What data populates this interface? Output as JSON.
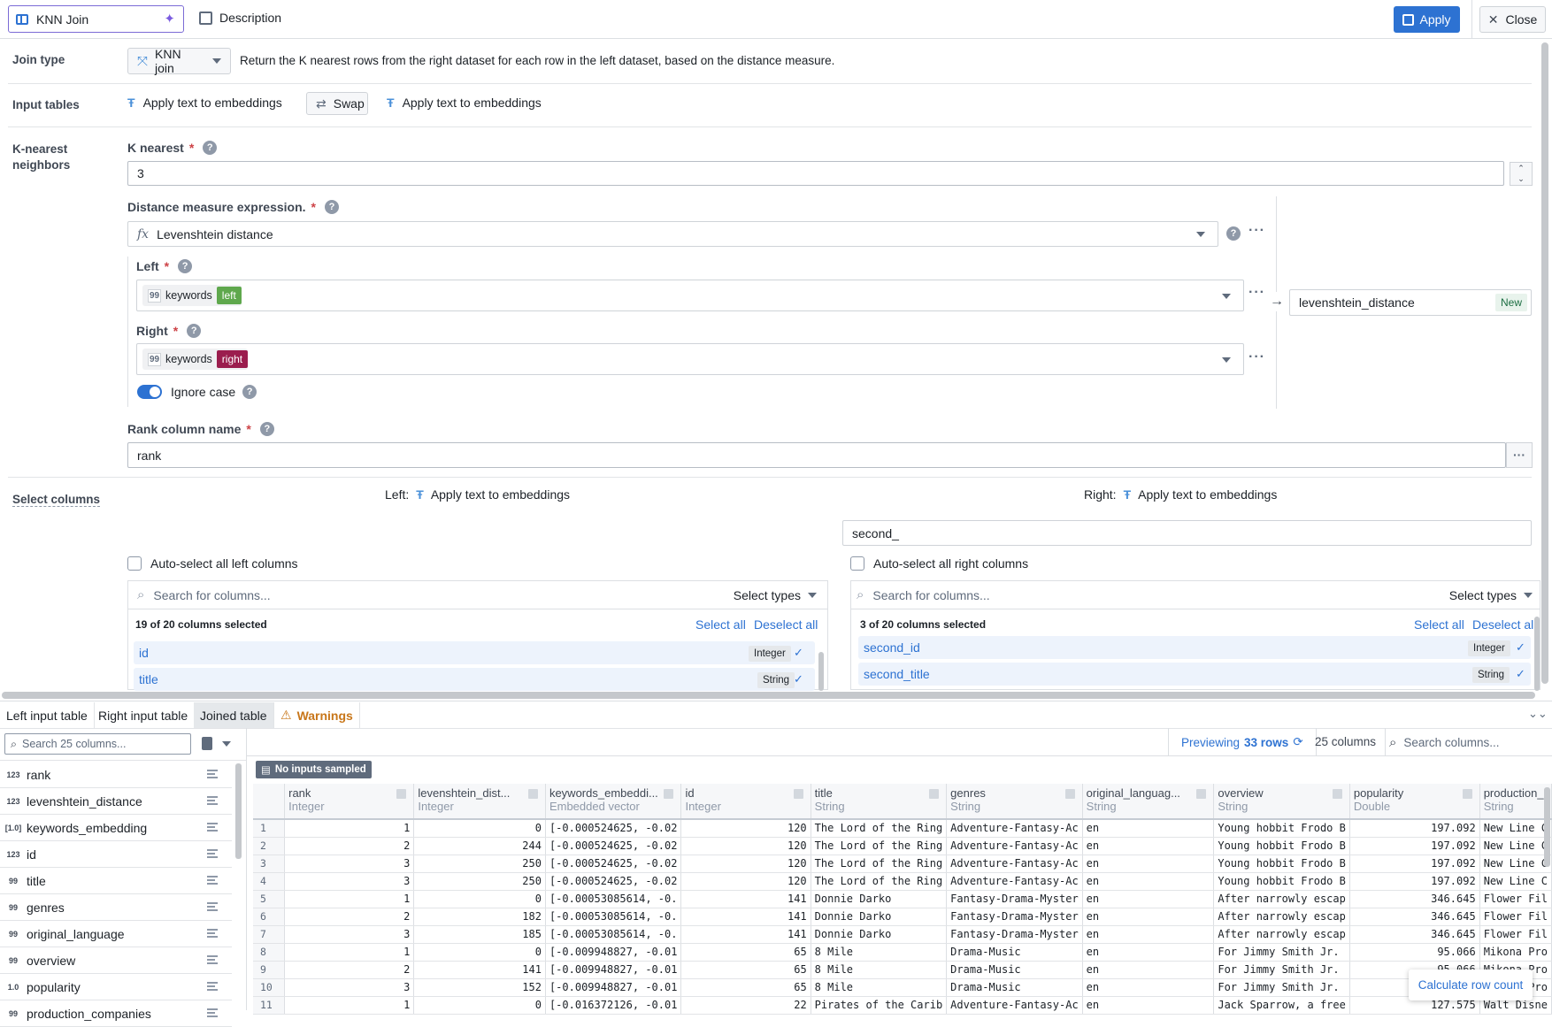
{
  "topbar": {
    "title": "KNN Join",
    "description_label": "Description",
    "apply_label": "Apply",
    "close_label": "Close"
  },
  "join_type": {
    "label": "Join type",
    "value": "KNN join",
    "description": "Return the K nearest rows from the right dataset for each row in the left dataset, based on the distance measure."
  },
  "input_tables": {
    "label": "Input tables",
    "left": "Apply text to embeddings",
    "swap_label": "Swap",
    "right": "Apply text to embeddings"
  },
  "knn": {
    "section_label_1": "K-nearest",
    "section_label_2": "neighbors",
    "k_label": "K nearest",
    "k_value": "3",
    "distance_label": "Distance measure expression.",
    "distance_value": "Levenshtein distance",
    "left_label": "Left",
    "left_column": "keywords",
    "left_tag": "left",
    "right_label": "Right",
    "right_column": "keywords",
    "right_tag": "right",
    "ignore_case_label": "Ignore case",
    "ignore_case_on": true,
    "output_column": "levenshtein_distance",
    "output_badge": "New",
    "rank_label": "Rank column name",
    "rank_value": "rank"
  },
  "select_columns": {
    "label": "Select columns",
    "left_prefix": "Left:",
    "left_source": "Apply text to embeddings",
    "right_prefix": "Right:",
    "right_source": "Apply text to embeddings",
    "right_prefix_input": "second_",
    "left_auto_select": "Auto-select all left columns",
    "right_auto_select": "Auto-select all right columns",
    "search_placeholder": "Search for columns...",
    "select_types": "Select types",
    "left_count": "19 of 20 columns selected",
    "right_count": "3 of 20 columns selected",
    "select_all": "Select all",
    "deselect_all": "Deselect all",
    "left_items": [
      {
        "name": "id",
        "type": "Integer"
      },
      {
        "name": "title",
        "type": "String"
      }
    ],
    "right_items": [
      {
        "name": "second_id",
        "type": "Integer"
      },
      {
        "name": "second_title",
        "type": "String"
      }
    ]
  },
  "bottom": {
    "tabs": [
      "Left input table",
      "Right input table",
      "Joined table",
      "Warnings"
    ],
    "active_tab": "Joined table",
    "sidebar_search_placeholder": "Search 25 columns...",
    "sidebar_columns": [
      {
        "type_icon": "123",
        "name": "rank"
      },
      {
        "type_icon": "123",
        "name": "levenshtein_distance"
      },
      {
        "type_icon": "[1.0]",
        "name": "keywords_embedding"
      },
      {
        "type_icon": "123",
        "name": "id"
      },
      {
        "type_icon": "99",
        "name": "title"
      },
      {
        "type_icon": "99",
        "name": "genres"
      },
      {
        "type_icon": "99",
        "name": "original_language"
      },
      {
        "type_icon": "99",
        "name": "overview"
      },
      {
        "type_icon": "1.0",
        "name": "popularity"
      },
      {
        "type_icon": "99",
        "name": "production_companies"
      }
    ],
    "previewing_label": "Previewing",
    "previewing_rows": "33 rows",
    "columns_count": "25 columns",
    "search_columns_placeholder": "Search columns...",
    "no_inputs_badge": "No inputs sampled",
    "calculate_row_count": "Calculate row count",
    "table": {
      "columns": [
        {
          "name": "rank",
          "type": "Integer"
        },
        {
          "name": "levenshtein_dist...",
          "type": "Integer"
        },
        {
          "name": "keywords_embeddi...",
          "type": "Embedded vector"
        },
        {
          "name": "id",
          "type": "Integer"
        },
        {
          "name": "title",
          "type": "String"
        },
        {
          "name": "genres",
          "type": "String"
        },
        {
          "name": "original_languag...",
          "type": "String"
        },
        {
          "name": "overview",
          "type": "String"
        },
        {
          "name": "popularity",
          "type": "Double"
        },
        {
          "name": "production_",
          "type": "String"
        }
      ],
      "rows": [
        [
          "1",
          "1",
          "0",
          "[-0.000524625, -0.02",
          "120",
          "The Lord of the Ring",
          "Adventure-Fantasy-Ac",
          "en",
          "Young hobbit Frodo B",
          "197.092",
          "New Line C"
        ],
        [
          "2",
          "2",
          "244",
          "[-0.000524625, -0.02",
          "120",
          "The Lord of the Ring",
          "Adventure-Fantasy-Ac",
          "en",
          "Young hobbit Frodo B",
          "197.092",
          "New Line C"
        ],
        [
          "3",
          "3",
          "250",
          "[-0.000524625, -0.02",
          "120",
          "The Lord of the Ring",
          "Adventure-Fantasy-Ac",
          "en",
          "Young hobbit Frodo B",
          "197.092",
          "New Line C"
        ],
        [
          "4",
          "3",
          "250",
          "[-0.000524625, -0.02",
          "120",
          "The Lord of the Ring",
          "Adventure-Fantasy-Ac",
          "en",
          "Young hobbit Frodo B",
          "197.092",
          "New Line C"
        ],
        [
          "5",
          "1",
          "0",
          "[-0.00053085614, -0.",
          "141",
          "Donnie Darko",
          "Fantasy-Drama-Myster",
          "en",
          "After narrowly escap",
          "346.645",
          "Flower Fil"
        ],
        [
          "6",
          "2",
          "182",
          "[-0.00053085614, -0.",
          "141",
          "Donnie Darko",
          "Fantasy-Drama-Myster",
          "en",
          "After narrowly escap",
          "346.645",
          "Flower Fil"
        ],
        [
          "7",
          "3",
          "185",
          "[-0.00053085614, -0.",
          "141",
          "Donnie Darko",
          "Fantasy-Drama-Myster",
          "en",
          "After narrowly escap",
          "346.645",
          "Flower Fil"
        ],
        [
          "8",
          "1",
          "0",
          "[-0.009948827, -0.01",
          "65",
          "8 Mile",
          "Drama-Music",
          "en",
          "For Jimmy Smith Jr.",
          "95.066",
          "Mikona Pro"
        ],
        [
          "9",
          "2",
          "141",
          "[-0.009948827, -0.01",
          "65",
          "8 Mile",
          "Drama-Music",
          "en",
          "For Jimmy Smith Jr.",
          "95.066",
          "Mikona Pro"
        ],
        [
          "10",
          "3",
          "152",
          "[-0.009948827, -0.01",
          "65",
          "8 Mile",
          "Drama-Music",
          "en",
          "For Jimmy Smith Jr.",
          "95.066",
          "Mikona Pro"
        ],
        [
          "11",
          "1",
          "0",
          "[-0.016372126, -0.01",
          "22",
          "Pirates of the Carib",
          "Adventure-Fantasy-Ac",
          "en",
          "Jack Sparrow, a free",
          "127.575",
          "Walt Disne"
        ]
      ]
    }
  },
  "colors": {
    "accent": "#2d72d2",
    "left_tag": "#5fa84d",
    "right_tag": "#9b1d4e",
    "warning": "#c87619",
    "title_border": "#7b6bd6"
  }
}
